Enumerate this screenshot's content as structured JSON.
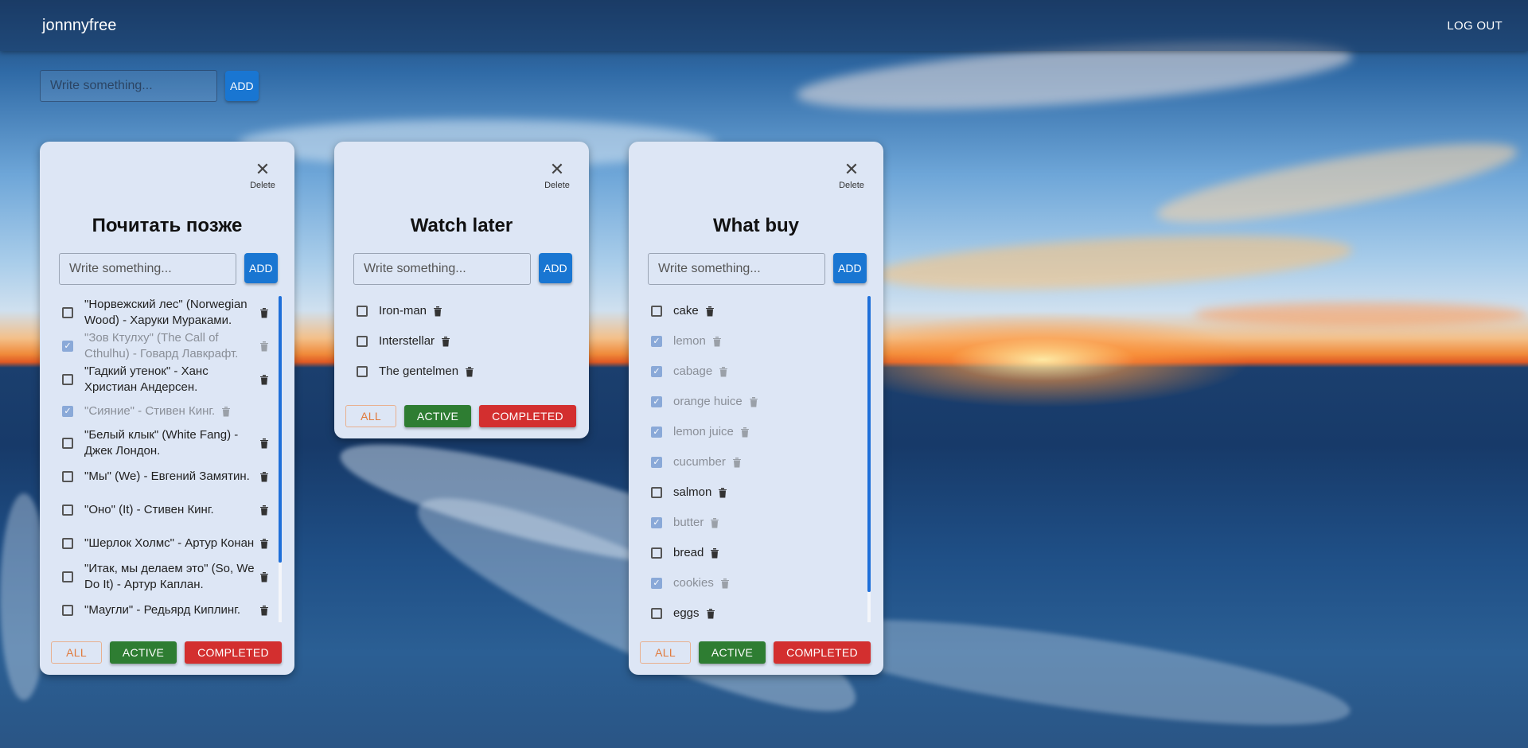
{
  "header": {
    "brand": "jonnnyfree",
    "logout_label": "LOG OUT"
  },
  "global_form": {
    "placeholder": "Write something...",
    "add_label": "ADD"
  },
  "card_common": {
    "delete_label": "Delete",
    "placeholder": "Write something...",
    "add_label": "ADD",
    "filter_all": "ALL",
    "filter_active": "ACTIVE",
    "filter_completed": "COMPLETED"
  },
  "cards": [
    {
      "title": "Почитать позже",
      "items": [
        {
          "text": "\"Норвежский лес\" (Norwegian Wood) - Харуки Мураками.",
          "done": false
        },
        {
          "text": "\"Зов Ктулху\" (The Call of Cthulhu) - Говард Лавкрафт.",
          "done": true
        },
        {
          "text": "\"Гадкий утенок\" - Ханс Христиан Андерсен.",
          "done": false
        },
        {
          "text": "\"Сияние\" - Стивен Кинг.",
          "done": true
        },
        {
          "text": "\"Белый клык\" (White Fang) - Джек Лондон.",
          "done": false
        },
        {
          "text": "\"Мы\" (We) - Евгений Замятин.",
          "done": false
        },
        {
          "text": "\"Оно\" (It) - Стивен Кинг.",
          "done": false
        },
        {
          "text": "\"Шерлок Холмс\" - Артур Конан",
          "done": false
        },
        {
          "text": "\"Итак, мы делаем это\" (So, We Do It) - Артур Каплан.",
          "done": false
        },
        {
          "text": "\"Маугли\" - Редьярд Киплинг.",
          "done": false
        }
      ]
    },
    {
      "title": "Watch later",
      "items": [
        {
          "text": "Iron-man",
          "done": false
        },
        {
          "text": "Interstellar",
          "done": false
        },
        {
          "text": "The gentelmen",
          "done": false
        }
      ]
    },
    {
      "title": "What buy",
      "items": [
        {
          "text": "cake",
          "done": false
        },
        {
          "text": "lemon",
          "done": true
        },
        {
          "text": "cabage",
          "done": true
        },
        {
          "text": "orange huice",
          "done": true
        },
        {
          "text": "lemon juice",
          "done": true
        },
        {
          "text": "cucumber",
          "done": true
        },
        {
          "text": "salmon",
          "done": false
        },
        {
          "text": "butter",
          "done": true
        },
        {
          "text": "bread",
          "done": false
        },
        {
          "text": "cookies",
          "done": true
        },
        {
          "text": "eggs",
          "done": false
        }
      ]
    }
  ]
}
